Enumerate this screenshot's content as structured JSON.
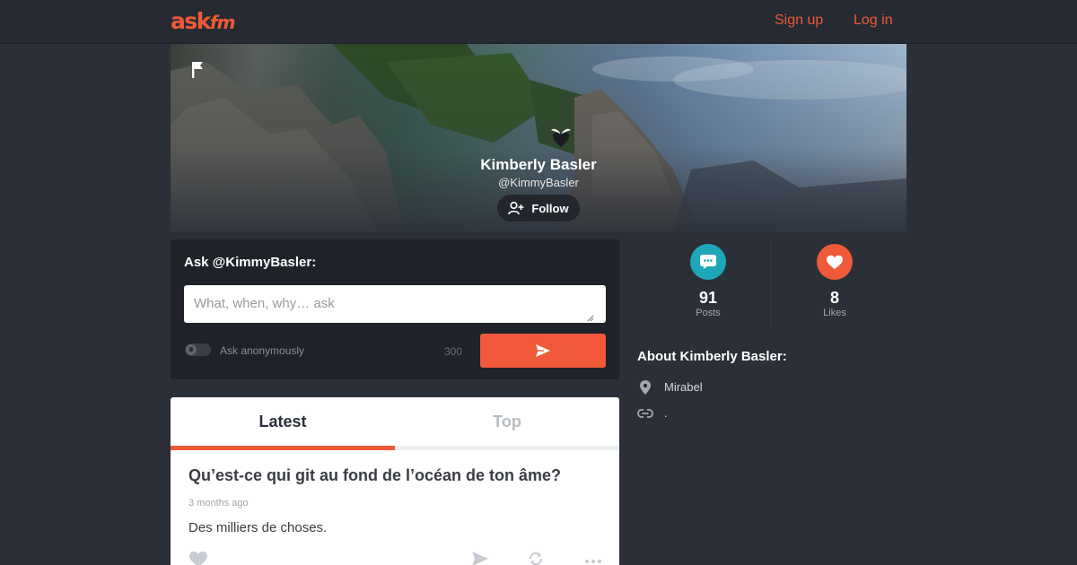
{
  "header": {
    "logo_main": "ask",
    "logo_suffix": "fm",
    "signup_label": "Sign up",
    "login_label": "Log in"
  },
  "profile": {
    "name": "Kimberly Basler",
    "handle": "@KimmyBasler",
    "follow_label": "Follow"
  },
  "ask": {
    "label": "Ask @KimmyBasler:",
    "placeholder": "What, when, why… ask",
    "anonymous_label": "Ask anonymously",
    "char_limit": "300"
  },
  "feed": {
    "tabs": [
      {
        "label": "Latest",
        "active": true
      },
      {
        "label": "Top",
        "active": false
      }
    ],
    "posts": [
      {
        "question": "Qu’est-ce qui git au fond de l’océan de ton âme?",
        "time": "3 months ago",
        "answer": "Des milliers de choses."
      }
    ]
  },
  "stats": {
    "posts_count": "91",
    "posts_label": "Posts",
    "likes_count": "8",
    "likes_label": "Likes"
  },
  "about": {
    "title": "About Kimberly Basler:",
    "location": "Mirabel",
    "link": "."
  },
  "colors": {
    "accent": "#ee5a36",
    "posts_icon_bg": "#1ea7b8",
    "likes_icon_bg": "#f0593a",
    "background": "#2b2f38"
  }
}
